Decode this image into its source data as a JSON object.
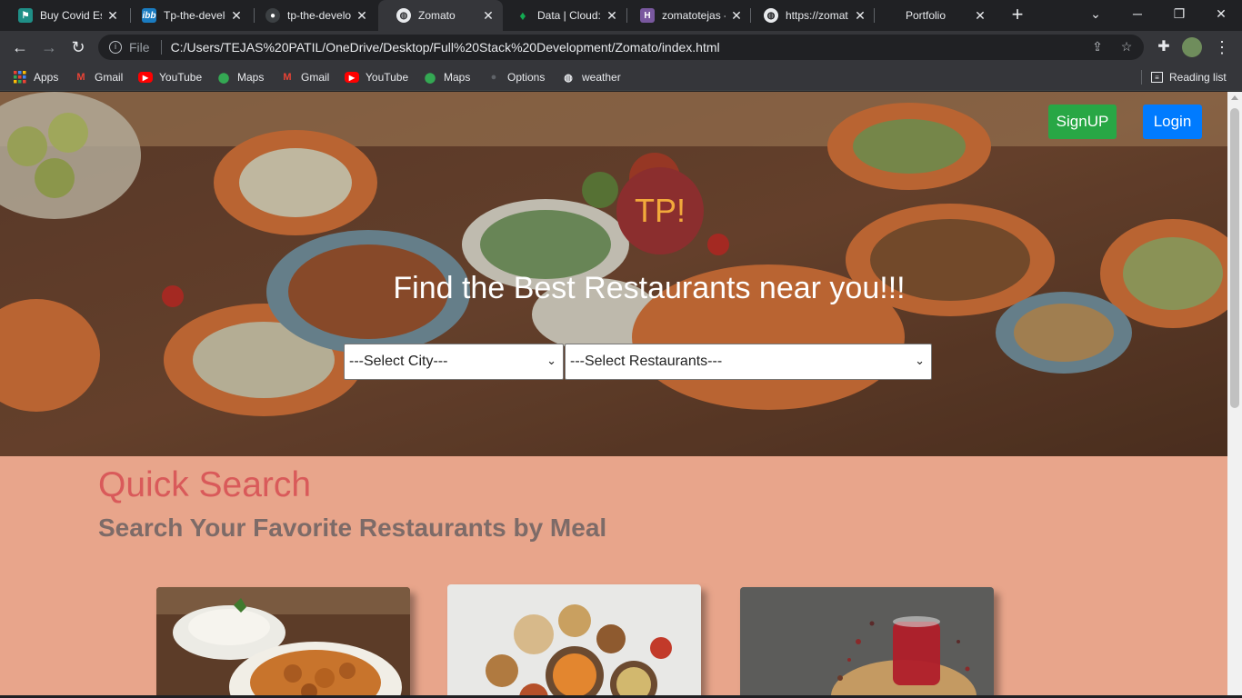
{
  "browser": {
    "tabs": [
      {
        "title": "Buy Covid Ess",
        "icon": "covid-shop-icon",
        "color": "#1f8f87"
      },
      {
        "title": "Tp-the-develo",
        "icon": "ibb-icon",
        "color": "#1a7cc1"
      },
      {
        "title": "tp-the-develo",
        "icon": "github-icon",
        "color": "#24292e"
      },
      {
        "title": "Zomato",
        "icon": "globe-icon",
        "color": "#9aa0a6",
        "active": true
      },
      {
        "title": "Data | Cloud:",
        "icon": "mongodb-leaf-icon",
        "color": "#13aa52"
      },
      {
        "title": "zomatotejas -",
        "icon": "heroku-icon",
        "color": "#79589f"
      },
      {
        "title": "https://zomat",
        "icon": "globe-icon",
        "color": "#9aa0a6"
      },
      {
        "title": "Portfolio",
        "icon": "",
        "color": ""
      }
    ],
    "address": {
      "scheme_label": "File",
      "url": "C:/Users/TEJAS%20PATIL/OneDrive/Desktop/Full%20Stack%20Development/Zomato/index.html"
    },
    "bookmarks": [
      {
        "label": "Apps",
        "icon": "apps-grid-icon"
      },
      {
        "label": "Gmail",
        "icon": "gmail-icon"
      },
      {
        "label": "YouTube",
        "icon": "youtube-icon"
      },
      {
        "label": "Maps",
        "icon": "maps-pin-icon"
      },
      {
        "label": "Gmail",
        "icon": "gmail-icon"
      },
      {
        "label": "YouTube",
        "icon": "youtube-icon"
      },
      {
        "label": "Maps",
        "icon": "maps-pin-icon"
      },
      {
        "label": "Options",
        "icon": "github-icon"
      },
      {
        "label": "weather",
        "icon": "globe-icon"
      }
    ],
    "reading_list": "Reading list"
  },
  "page": {
    "header": {
      "signup": "SignUP",
      "login": "Login"
    },
    "logo": "TP!",
    "tagline": "Find the Best Restaurants near you!!!",
    "city_select": "---Select City---",
    "restaurant_select": "---Select Restaurants---",
    "quick_search": {
      "title": "Quick Search",
      "subtitle": "Search Your Favorite Restaurants by Meal"
    }
  },
  "colors": {
    "signup": "#28a745",
    "login": "#007bff",
    "page_bg": "#e8a58b",
    "title": "#d95a5a"
  }
}
